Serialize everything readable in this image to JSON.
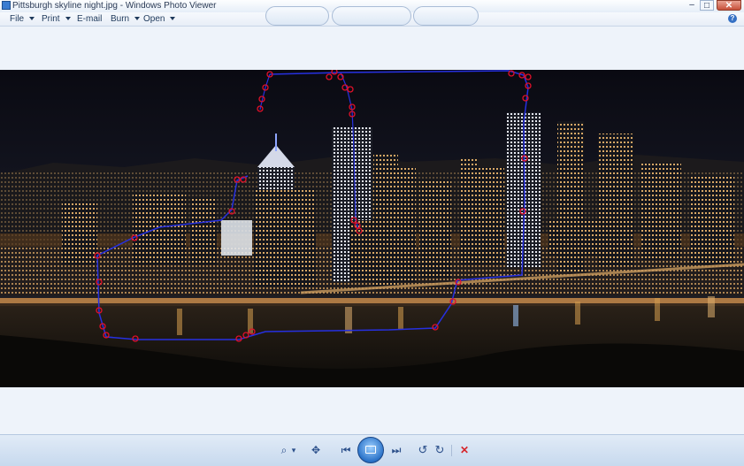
{
  "window": {
    "title": "Pittsburgh skyline night.jpg - Windows Photo Viewer"
  },
  "window_controls": {
    "minimize": "–",
    "maximize": "□",
    "close": "✕"
  },
  "menu": {
    "items": [
      "File",
      "Print",
      "E-mail",
      "Burn",
      "Open"
    ],
    "has_dropdown": [
      true,
      true,
      false,
      true,
      true
    ]
  },
  "help": {
    "label": "?"
  },
  "toolbar": {
    "zoom_icon": "magnifier-icon",
    "zoom_caret": "▾",
    "fit_icon": "actual-size-icon",
    "previous_icon": "previous-icon",
    "slideshow_icon": "slideshow-icon",
    "next_icon": "next-icon",
    "rotate_ccw_icon": "rotate-counterclockwise-icon",
    "rotate_cw_icon": "rotate-clockwise-icon",
    "delete_icon": "delete-icon",
    "glyphs": {
      "zoom": "⌕",
      "fit": "✥",
      "previous": "⏮",
      "next": "⏭",
      "rotate_ccw": "↺",
      "rotate_cw": "↻",
      "delete": "✕"
    }
  },
  "colors": {
    "selection_line": "#2630e0",
    "selection_points": "#e0102a",
    "delete_red": "#d6262b",
    "accent_blue": "#2a72c8"
  }
}
